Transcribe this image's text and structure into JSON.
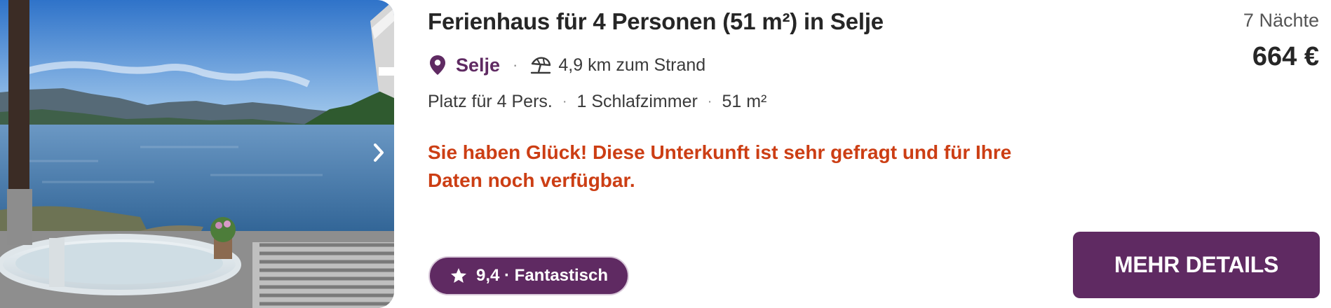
{
  "listing": {
    "title": "Ferienhaus für 4 Personen (51 m²) in Selje",
    "location": "Selje",
    "beach_distance": "4,9 km zum Strand",
    "facts": [
      "Platz für 4 Pers.",
      "1 Schlafzimmer",
      "51 m²"
    ],
    "separator": "·",
    "alert_line1": "Sie haben Glück! Diese Unterkunft ist sehr gefragt und für Ihre",
    "alert_line2": "Daten noch verfügbar.",
    "rating_text": "9,4 · Fantastisch"
  },
  "pricing": {
    "nights": "7 Nächte",
    "price": "664 €"
  },
  "actions": {
    "details_label": "MEHR DETAILS"
  },
  "icons": {
    "location": "map-pin-icon",
    "beach": "beach-umbrella-icon",
    "rating": "star-icon",
    "gallery_next": "chevron-right-icon"
  },
  "colors": {
    "brand": "#5f2a62",
    "alert": "#cc3e14",
    "text": "#262626"
  }
}
